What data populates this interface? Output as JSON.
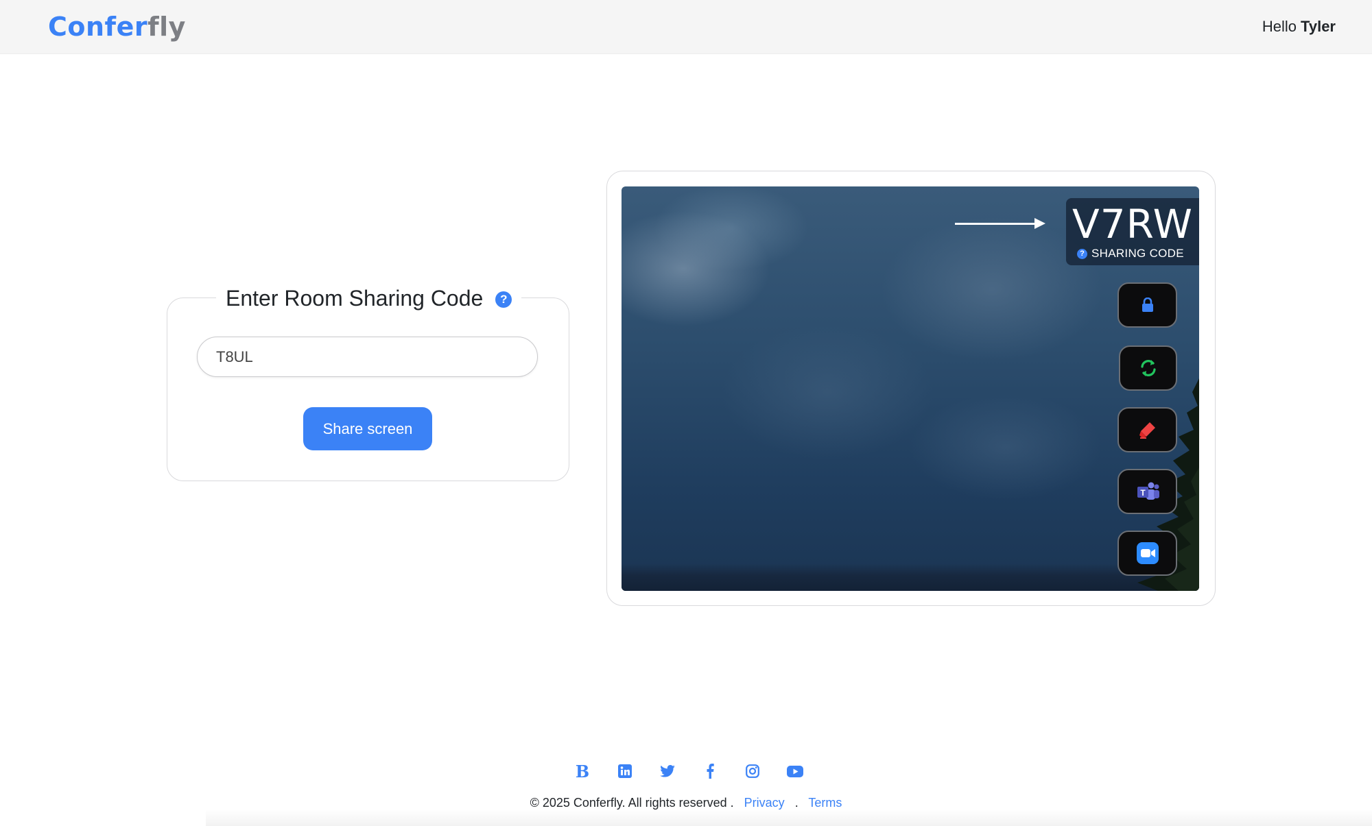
{
  "app": {
    "logo_part1": "Confer",
    "logo_part2": "fly",
    "greeting": "Hello",
    "user_name": "Tyler"
  },
  "join_card": {
    "title": "Enter Room Sharing Code",
    "help_glyph": "?",
    "input_value": "T8UL",
    "share_button_label": "Share screen"
  },
  "preview": {
    "sharing_code": "V7RW",
    "sharing_code_label": "SHARING CODE",
    "help_glyph": "?",
    "tools": [
      {
        "name": "lock-icon",
        "color": "#3b82f6"
      },
      {
        "name": "refresh-icon",
        "color": "#22c55e"
      },
      {
        "name": "marker-icon",
        "color": "#ef4444"
      },
      {
        "name": "teams-icon",
        "color": "#5b5fc7"
      },
      {
        "name": "zoom-video-icon",
        "color": "#2d8cff"
      }
    ]
  },
  "footer": {
    "social_icons": [
      "blog-b-icon",
      "linkedin-icon",
      "twitter-icon",
      "facebook-icon",
      "instagram-icon",
      "youtube-icon"
    ],
    "blog_glyph": "B",
    "copyright": "© 2025 Conferfly. All rights reserved .",
    "privacy_label": "Privacy",
    "separator": ".",
    "terms_label": "Terms"
  },
  "colors": {
    "accent": "#3b82f6",
    "logo_grey": "#7d7f84",
    "header_bg": "#f5f5f5"
  }
}
